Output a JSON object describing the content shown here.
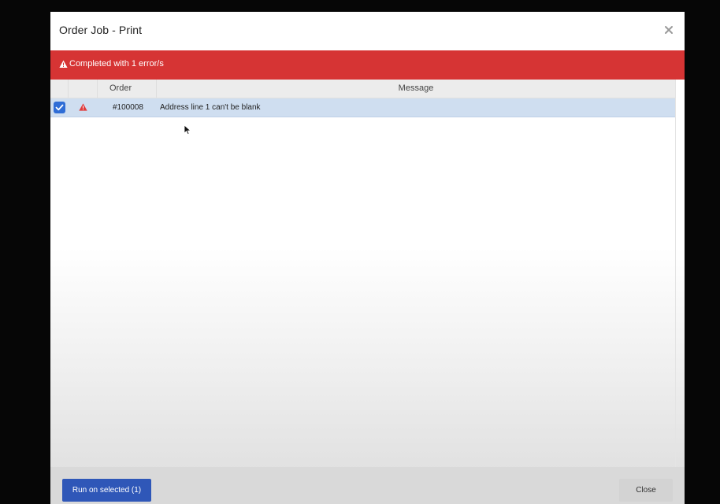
{
  "dialog": {
    "title": "Order Job - Print",
    "close_icon": "close-icon"
  },
  "alert": {
    "icon": "warning-icon",
    "text": "Completed with 1 error/s",
    "color": "#d63434"
  },
  "table": {
    "columns": [
      "",
      "",
      "Order",
      "Message"
    ],
    "rows": [
      {
        "selected": true,
        "status_icon": "warning-icon",
        "order": "#100008",
        "message": "Address line 1 can't be blank"
      }
    ]
  },
  "footer": {
    "run_label": "Run on selected (1)",
    "close_label": "Close"
  },
  "colors": {
    "accent": "#2f57b8",
    "checkbox": "#2f6dd6",
    "selected_row": "#cfdef0",
    "error": "#d63434"
  }
}
